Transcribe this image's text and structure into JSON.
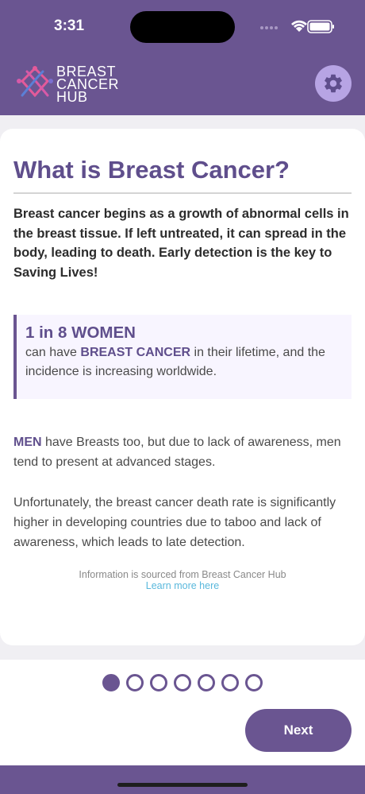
{
  "status_bar": {
    "time": "3:31"
  },
  "header": {
    "logo_lines": [
      "BREAST",
      "CANCER",
      "HUB"
    ],
    "settings_icon": "gear-icon",
    "colors": {
      "brand": "#6a5591",
      "settings_button": "#b7a4e4"
    }
  },
  "content": {
    "title": "What is Breast Cancer?",
    "intro": "Breast cancer begins as a growth of abnormal cells in the breast tissue. If left untreated, it can spread in the body, leading to death. Early detection is the key to Saving Lives!",
    "callout": {
      "heading": "1 in 8 WOMEN",
      "body_prefix": "can have ",
      "body_highlight": "BREAST CANCER",
      "body_suffix": " in their lifetime, and the incidence is increasing worldwide."
    },
    "men_paragraph": {
      "highlight": "MEN",
      "text": " have Breasts too, but due to lack of awareness, men tend to present at advanced stages."
    },
    "death_rate_paragraph": "Unfortunately, the breast cancer death rate is significantly higher in developing countries due to taboo and lack of awareness, which leads to late detection.",
    "source_note": "Information is sourced from Breast Cancer Hub",
    "learn_more_link": "Learn more here"
  },
  "pagination": {
    "total": 7,
    "current": 1
  },
  "footer": {
    "next_label": "Next"
  }
}
